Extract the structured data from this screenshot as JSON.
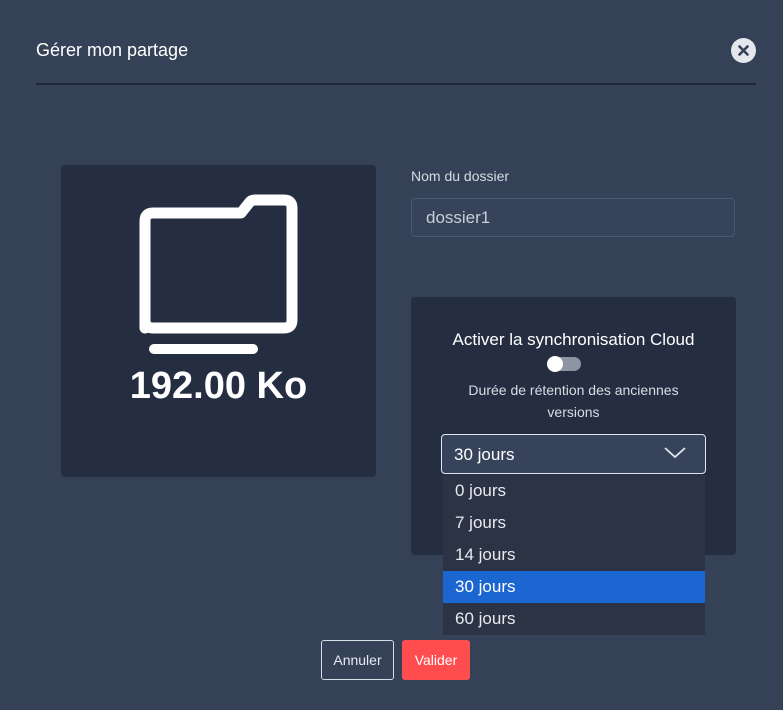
{
  "modal": {
    "title": "Gérer mon partage"
  },
  "preview": {
    "icon": "folder-icon",
    "size": "192.00 Ko"
  },
  "folder_name": {
    "label": "Nom du dossier",
    "value": "dossier1"
  },
  "sync": {
    "title": "Activer la synchronisation Cloud",
    "enabled": false,
    "retention_label": "Durée de rétention des anciennes versions",
    "selected": "30 jours",
    "options": [
      "0 jours",
      "7 jours",
      "14 jours",
      "30 jours",
      "60 jours"
    ]
  },
  "actions": {
    "cancel": "Annuler",
    "confirm": "Valider"
  },
  "colors": {
    "background": "#354157",
    "card": "#252e41",
    "confirm": "#ff4d4f",
    "selected_option": "#1c66d2"
  }
}
